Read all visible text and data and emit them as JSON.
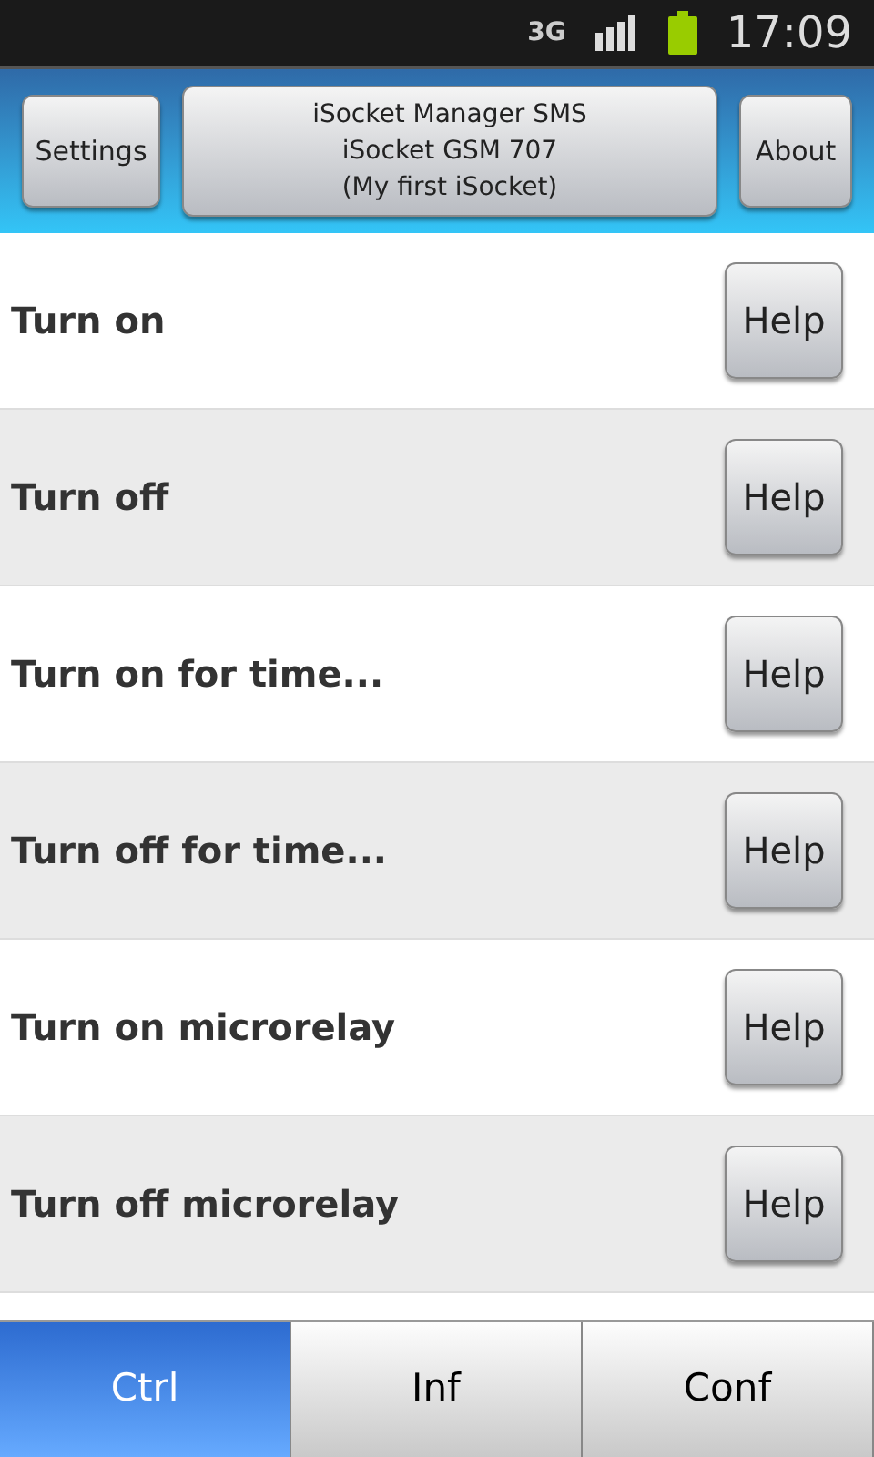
{
  "status_bar": {
    "network": "3G",
    "time": "17:09"
  },
  "header": {
    "left_button": "Settings",
    "title_lines": [
      "iSocket Manager SMS",
      "iSocket GSM 707",
      "(My first iSocket)"
    ],
    "right_button": "About"
  },
  "commands": [
    {
      "label": "Turn on",
      "help": "Help"
    },
    {
      "label": "Turn off",
      "help": "Help"
    },
    {
      "label": "Turn on for time...",
      "help": "Help"
    },
    {
      "label": "Turn off for time...",
      "help": "Help"
    },
    {
      "label": "Turn on microrelay",
      "help": "Help"
    },
    {
      "label": "Turn off microrelay",
      "help": "Help"
    }
  ],
  "tabs": [
    {
      "label": "Ctrl",
      "selected": true
    },
    {
      "label": "Inf",
      "selected": false
    },
    {
      "label": "Conf",
      "selected": false
    }
  ]
}
